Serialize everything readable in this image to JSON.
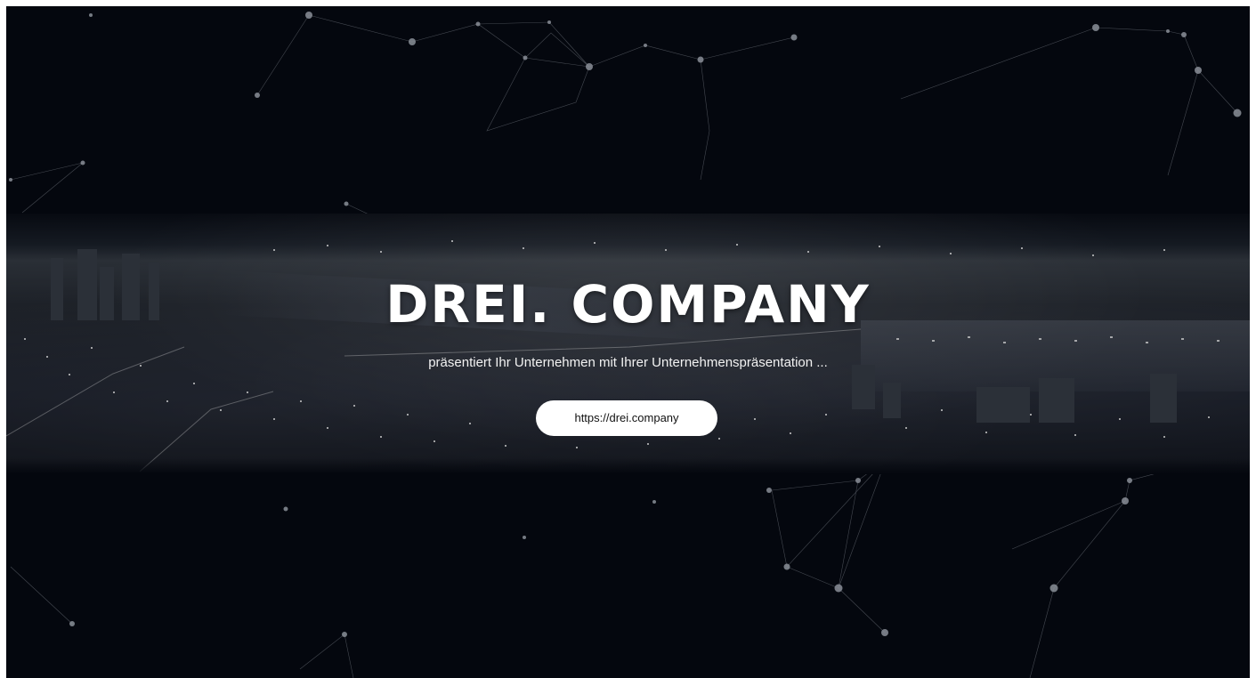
{
  "hero": {
    "title": "DREI. COMPANY",
    "subtitle": "präsentiert Ihr Unternehmen mit Ihrer Unternehmenspräsentation ...",
    "button_label": "https://drei.company"
  },
  "colors": {
    "background": "#04070e",
    "text": "#ffffff",
    "button_bg": "#ffffff",
    "button_text": "#111111",
    "network_line": "#7a7f88",
    "network_node": "#8a8f98"
  },
  "decor": {
    "background_image": "night-city-skyline",
    "network_overlay": "particle-network"
  }
}
